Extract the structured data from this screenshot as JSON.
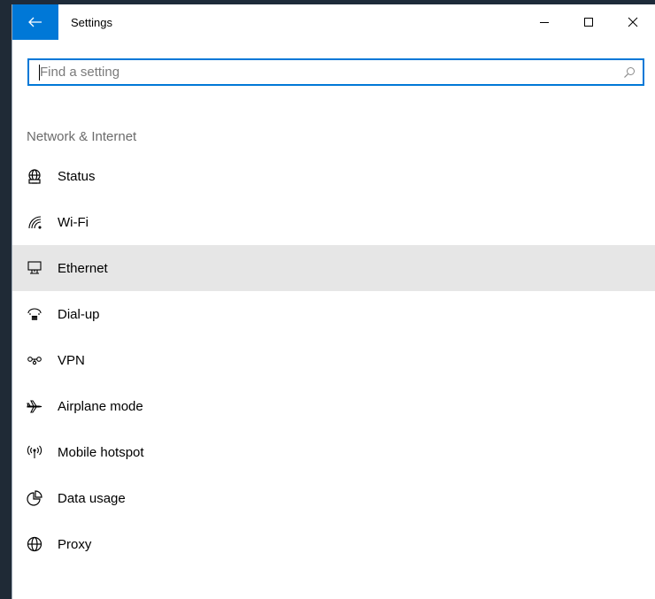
{
  "window": {
    "title": "Settings",
    "controls": {
      "minimize": "—",
      "maximize": "☐",
      "close": "✕"
    }
  },
  "search": {
    "placeholder": "Find a setting",
    "value": ""
  },
  "section": {
    "title": "Network & Internet"
  },
  "nav": {
    "items": [
      {
        "label": "Status",
        "icon": "globe-status-icon"
      },
      {
        "label": "Wi-Fi",
        "icon": "wifi-icon"
      },
      {
        "label": "Ethernet",
        "icon": "ethernet-icon",
        "selected": true
      },
      {
        "label": "Dial-up",
        "icon": "dialup-icon"
      },
      {
        "label": "VPN",
        "icon": "vpn-icon"
      },
      {
        "label": "Airplane mode",
        "icon": "airplane-icon"
      },
      {
        "label": "Mobile hotspot",
        "icon": "hotspot-icon"
      },
      {
        "label": "Data usage",
        "icon": "data-usage-icon"
      },
      {
        "label": "Proxy",
        "icon": "proxy-globe-icon"
      }
    ]
  },
  "colors": {
    "accent": "#0078d7",
    "selected_bg": "#e6e6e6",
    "frame": "#1f2a36"
  }
}
